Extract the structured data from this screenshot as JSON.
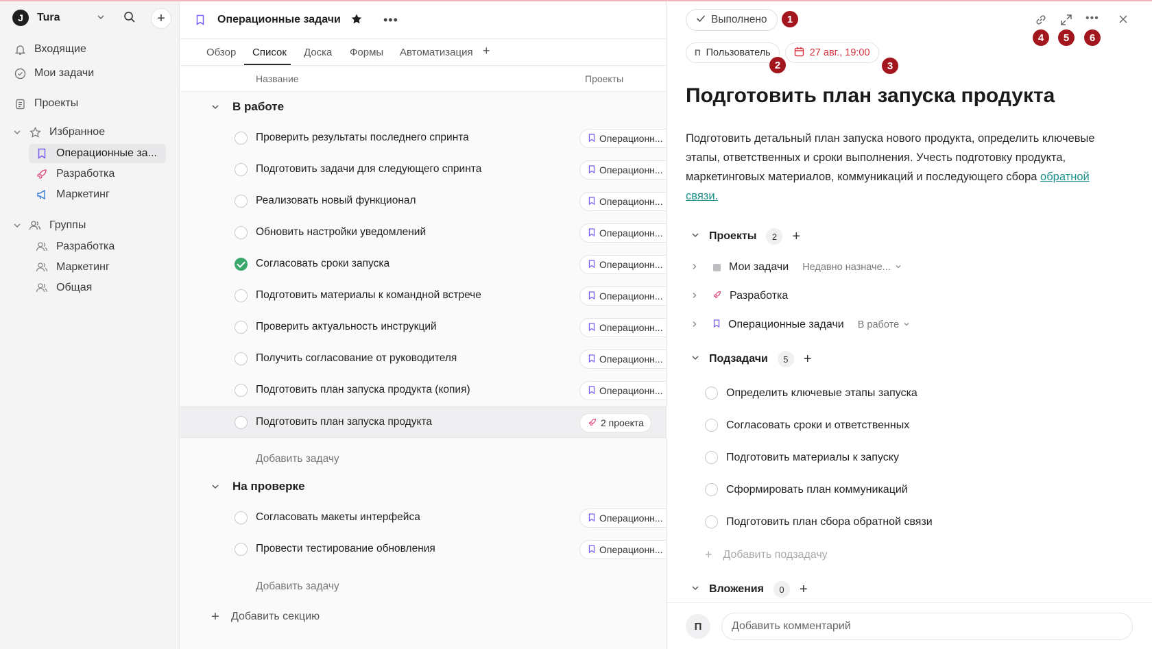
{
  "sidebar": {
    "workspace": "Tura",
    "logo_letter": "J",
    "nav": [
      {
        "label": "Входящие",
        "icon": "bell-icon"
      },
      {
        "label": "Мои задачи",
        "icon": "check-circle-icon"
      },
      {
        "label": "Проекты",
        "icon": "clipboard-icon"
      }
    ],
    "favorites_label": "Избранное",
    "favorites": [
      {
        "label": "Операционные за...",
        "icon": "bookmark-icon",
        "color": "#7b5cf0"
      },
      {
        "label": "Разработка",
        "icon": "rocket-icon",
        "color": "#e0507a"
      },
      {
        "label": "Маркетинг",
        "icon": "megaphone-icon",
        "color": "#3a7bd5"
      }
    ],
    "groups_label": "Группы",
    "groups": [
      {
        "label": "Разработка",
        "icon": "users-icon"
      },
      {
        "label": "Маркетинг",
        "icon": "users-icon"
      },
      {
        "label": "Общая",
        "icon": "users-icon"
      }
    ]
  },
  "project": {
    "title": "Операционные задачи",
    "tabs": [
      "Обзор",
      "Список",
      "Доска",
      "Формы",
      "Автоматизация"
    ],
    "active_tab": "Список",
    "col_name": "Название",
    "col_projects": "Проекты",
    "sections": [
      {
        "title": "В работе",
        "tasks": [
          {
            "title": "Проверить результаты последнего спринта",
            "project": "Операционн...",
            "done": false
          },
          {
            "title": "Подготовить задачи для следующего спринта",
            "project": "Операционн...",
            "done": false
          },
          {
            "title": "Реализовать новый функционал",
            "project": "Операционн...",
            "done": false
          },
          {
            "title": "Обновить настройки уведомлений",
            "project": "Операционн...",
            "done": false
          },
          {
            "title": "Согласовать сроки запуска",
            "project": "Операционн...",
            "done": true
          },
          {
            "title": "Подготовить материалы к командной встрече",
            "project": "Операционн...",
            "done": false
          },
          {
            "title": "Проверить актуальность инструкций",
            "project": "Операционн...",
            "done": false
          },
          {
            "title": "Получить согласование от руководителя",
            "project": "Операционн...",
            "done": false
          },
          {
            "title": "Подготовить план запуска продукта (копия)",
            "project": "Операционн...",
            "done": false
          },
          {
            "title": "Подготовить план запуска продукта",
            "project": "2 проекта",
            "done": false,
            "selected": true
          }
        ],
        "add_task": "Добавить задачу"
      },
      {
        "title": "На проверке",
        "tasks": [
          {
            "title": "Согласовать макеты интерфейса",
            "project": "Операционн...",
            "done": false
          },
          {
            "title": "Провести тестирование обновления",
            "project": "Операционн...",
            "done": false
          }
        ],
        "add_task": "Добавить задачу"
      }
    ],
    "add_section": "Добавить секцию"
  },
  "detail": {
    "done_label": "Выполнено",
    "assignee_initial": "П",
    "assignee": "Пользователь",
    "due": "27 авг., 19:00",
    "markers": [
      "1",
      "2",
      "3",
      "4",
      "5",
      "6"
    ],
    "title": "Подготовить план запуска продукта",
    "description": "Подготовить детальный план запуска нового продукта, определить ключевые этапы, ответственных и сроки выполнения. Учесть подготовку продукта, маркетинговых материалов, коммуникаций и последующего сбора ",
    "description_link": "обратной связи.",
    "projects_label": "Проекты",
    "projects_count": "2",
    "projects": [
      {
        "name": "Мои задачи",
        "status": "Недавно назначе..."
      },
      {
        "name": "Разработка",
        "status": ""
      },
      {
        "name": "Операционные задачи",
        "status": "В работе"
      }
    ],
    "subtasks_label": "Подзадачи",
    "subtasks_count": "5",
    "subtasks": [
      "Определить ключевые этапы запуска",
      "Согласовать сроки и ответственных",
      "Подготовить материалы к запуску",
      "Сформировать план коммуникаций",
      "Подготовить план сбора обратной связи"
    ],
    "add_subtask": "Добавить подзадачу",
    "attachments_label": "Вложения",
    "attachments_count": "0",
    "comment_initial": "П",
    "comment_placeholder": "Добавить комментарий"
  }
}
